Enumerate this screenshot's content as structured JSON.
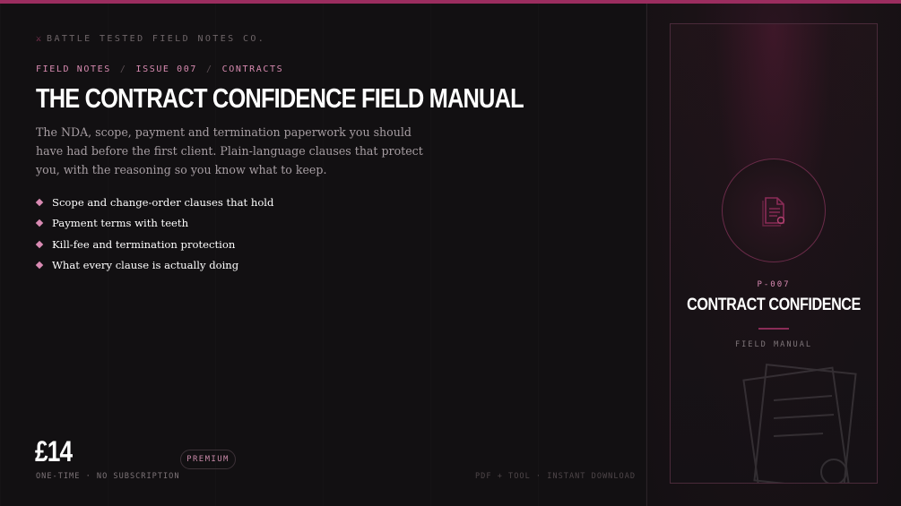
{
  "brand": {
    "icon": "crossed-swords-icon",
    "name": "BATTLE TESTED FIELD NOTES CO."
  },
  "breadcrumb": [
    "FIELD NOTES",
    "ISSUE 007",
    "CONTRACTS"
  ],
  "product": {
    "title": "THE CONTRACT CONFIDENCE FIELD MANUAL",
    "description": "The NDA, scope, payment and termination paperwork you should have had before the first client. Plain-language clauses that protect you, with the reasoning so you know what to keep.",
    "features": [
      "Scope and change-order clauses that hold",
      "Payment terms with teeth",
      "Kill-fee and termination protection",
      "What every clause is actually doing"
    ],
    "price": "£14",
    "price_note": "ONE-TIME · NO SUBSCRIPTION",
    "badge": "PREMIUM",
    "delivery": "PDF + TOOL · INSTANT DOWNLOAD"
  },
  "card": {
    "icon": "document-icon",
    "code": "P-007",
    "title": "CONTRACT CONFIDENCE",
    "subtitle": "FIELD MANUAL"
  },
  "colors": {
    "accent": "#9b2d5f",
    "accent_light": "#d98ab3",
    "background": "#121012"
  }
}
